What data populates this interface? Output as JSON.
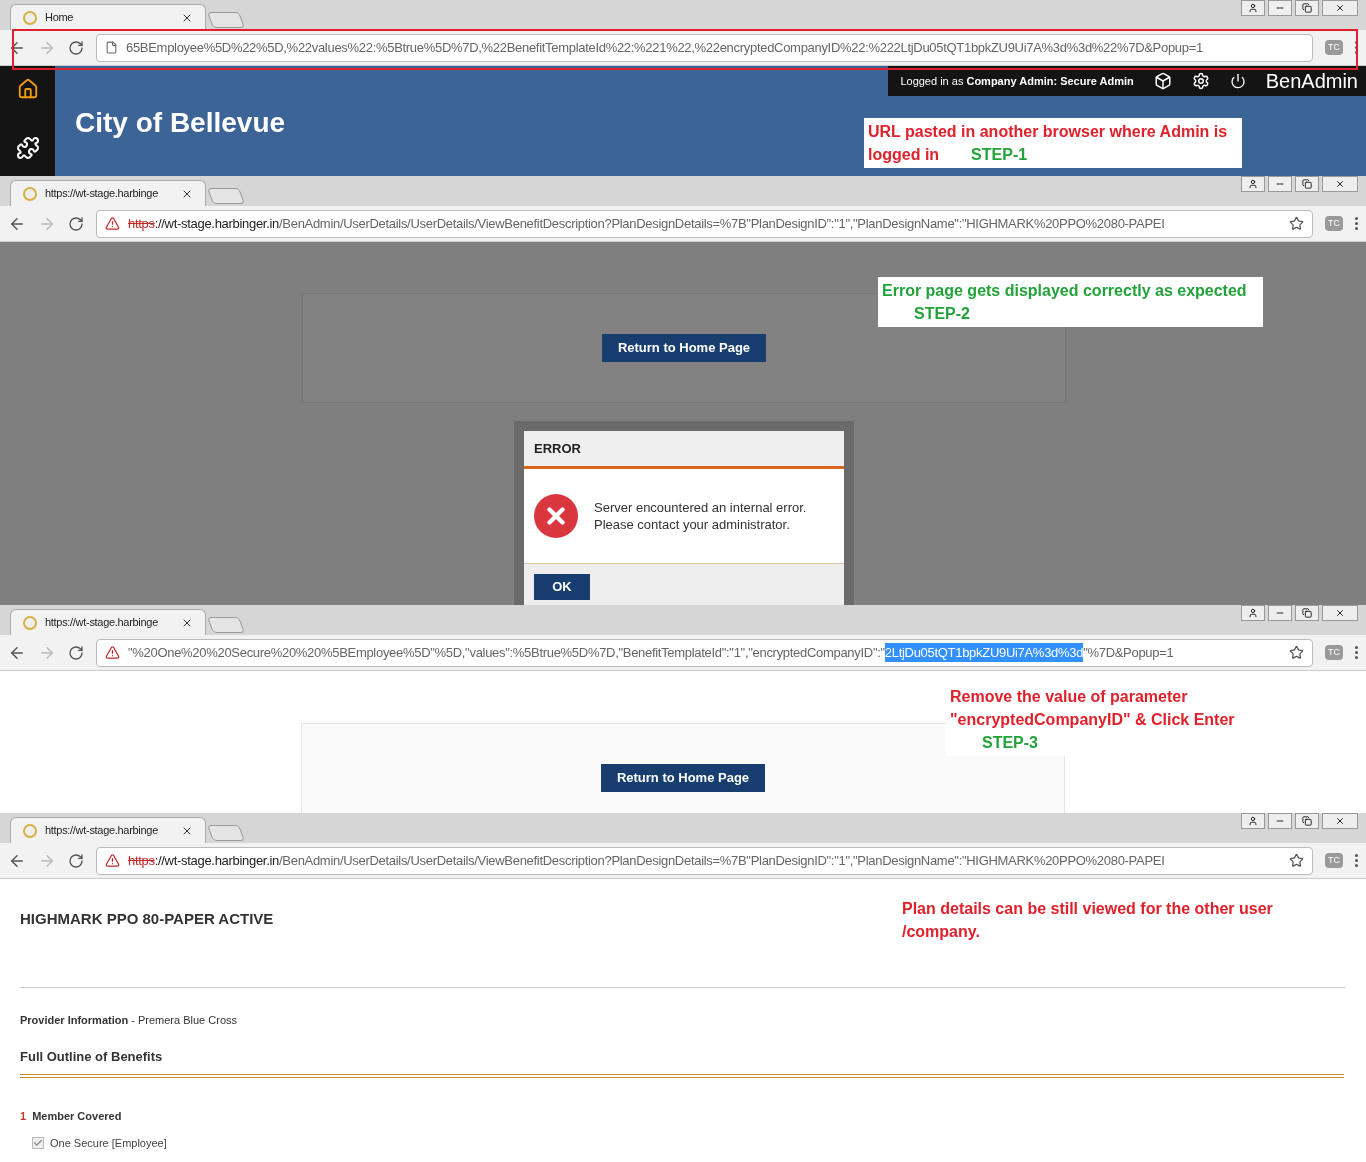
{
  "panels": [
    {
      "kind": "header",
      "outlined": true,
      "tab": {
        "title": "Home"
      },
      "url": {
        "secure_warning": false,
        "parts": [
          {
            "kind": "plain",
            "text": "65BEmployee%5D%22%5D,%22values%22:%5Btrue%5D%7D,%22BenefitTemplateId%22:%221%22,%22encryptedCompanyID%22:%222LtjDu05tQT1bpkZU9Ui7A%3d%3d%22%7D&Popup=1"
          }
        ]
      },
      "extension": "TC",
      "app": {
        "login": "Logged in as **Company Admin:  Secure Admin**",
        "brand": "BenAdmin",
        "org": "City of Bellevue"
      },
      "annotation": {
        "text": "URL pasted in another browser where Admin is logged in",
        "step": "STEP-1",
        "color": "#e0202a"
      }
    },
    {
      "kind": "error",
      "outlined": false,
      "tab": {
        "title": "https://wt-stage.harbinge"
      },
      "url": {
        "secure_warning": true,
        "parts": [
          {
            "kind": "struck",
            "text": "https"
          },
          {
            "kind": "host",
            "text": "://wt-stage.harbinger.in"
          },
          {
            "kind": "plain",
            "text": "/BenAdmin/UserDetails/UserDetails/ViewBenefitDescription?PlanDesignDetails=%7B\"PlanDesignID\":\"1\",\"PlanDesignName\":\"HIGHMARK%20PPO%2080-PAPEI"
          }
        ]
      },
      "extension": "TC",
      "return_button": "Return to Home Page",
      "dialog": {
        "title": "ERROR",
        "message": "Server encountered an internal error. Please contact your administrator.",
        "ok": "OK"
      },
      "annotation": {
        "text": "Error page gets displayed correctly as expected",
        "step": "STEP-2",
        "color": "#22a33a"
      }
    },
    {
      "kind": "blank",
      "outlined": false,
      "tab": {
        "title": "https://wt-stage.harbinge"
      },
      "url": {
        "secure_warning": true,
        "parts": [
          {
            "kind": "plain",
            "text": "\"%20One%20%20Secure%20%20%5BEmployee%5D\"%5D,\"values\":%5Btrue%5D%7D,\"BenefitTemplateId\":\"1\",\"encryptedCompanyID\":\""
          },
          {
            "kind": "selected",
            "text": "2LtjDu05tQT1bpkZU9Ui7A%3d%3d"
          },
          {
            "kind": "plain",
            "text": "\"%7D&Popup=1"
          }
        ]
      },
      "extension": "TC",
      "return_button": "Return to Home Page",
      "annotation": {
        "text": "Remove the value of parameter \"encryptedCompanyID\" & Click Enter",
        "step": "STEP-3",
        "color": "#e0202a"
      }
    },
    {
      "kind": "plan",
      "outlined": false,
      "tab": {
        "title": "https://wt-stage.harbinge"
      },
      "url": {
        "secure_warning": true,
        "parts": [
          {
            "kind": "struck",
            "text": "https"
          },
          {
            "kind": "host",
            "text": "://wt-stage.harbinger.in"
          },
          {
            "kind": "plain",
            "text": "/BenAdmin/UserDetails/UserDetails/ViewBenefitDescription?PlanDesignDetails=%7B\"PlanDesignID\":\"1\",\"PlanDesignName\":\"HIGHMARK%20PPO%2080-PAPEI"
          }
        ]
      },
      "extension": "TC",
      "plan": {
        "title": "HIGHMARK PPO 80-PAPER ACTIVE",
        "provider_label": "Provider Information",
        "provider_value": "- Premera Blue Cross",
        "section": "Full Outline of Benefits",
        "item_number": "1",
        "item_title": "Member Covered",
        "members": [
          {
            "label": "One Secure [Employee]",
            "checked": true
          }
        ]
      },
      "annotation": {
        "text": "Plan details can be still viewed for the other user /company.",
        "color": "#e0202a"
      }
    }
  ]
}
